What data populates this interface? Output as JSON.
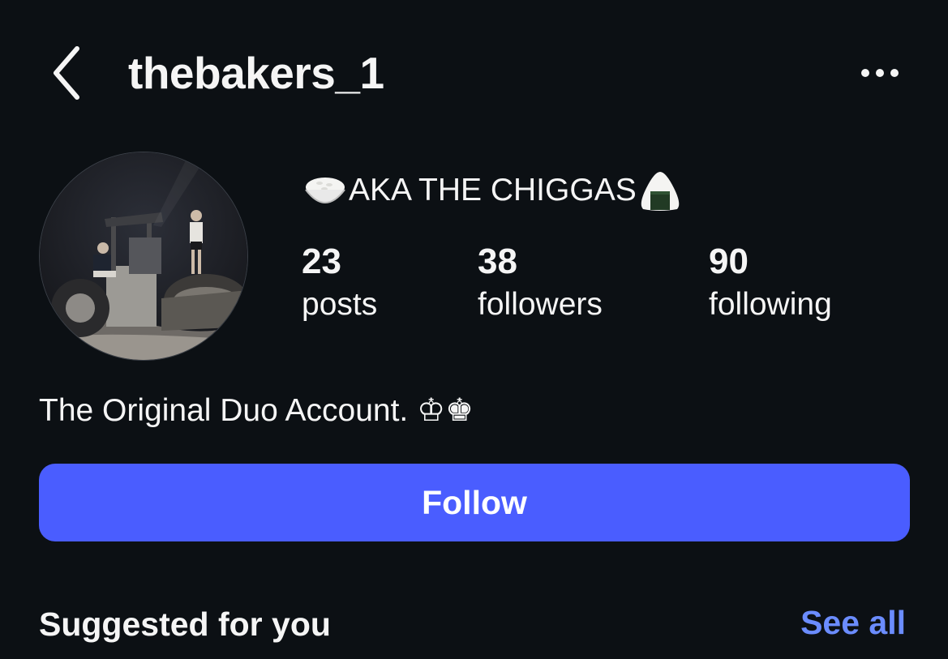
{
  "header": {
    "username": "thebakers_1",
    "back_icon": "chevron-left-icon",
    "more_icon": "more-horizontal-icon"
  },
  "profile": {
    "display_name": "AKA THE CHIGGAS",
    "display_name_emoji_left": "rice-bowl-emoji",
    "display_name_emoji_right": "rice-ball-emoji",
    "stats": {
      "posts": {
        "value": "23",
        "label": "posts"
      },
      "followers": {
        "value": "38",
        "label": "followers"
      },
      "following": {
        "value": "90",
        "label": "following"
      }
    },
    "bio": "The Original Duo Account. ♔♚"
  },
  "actions": {
    "follow_label": "Follow"
  },
  "suggested": {
    "title": "Suggested for you",
    "see_all_label": "See all"
  },
  "colors": {
    "background": "#0c1014",
    "follow_button": "#4a5dff",
    "link": "#6b8cff",
    "text": "#f5f5f5"
  }
}
